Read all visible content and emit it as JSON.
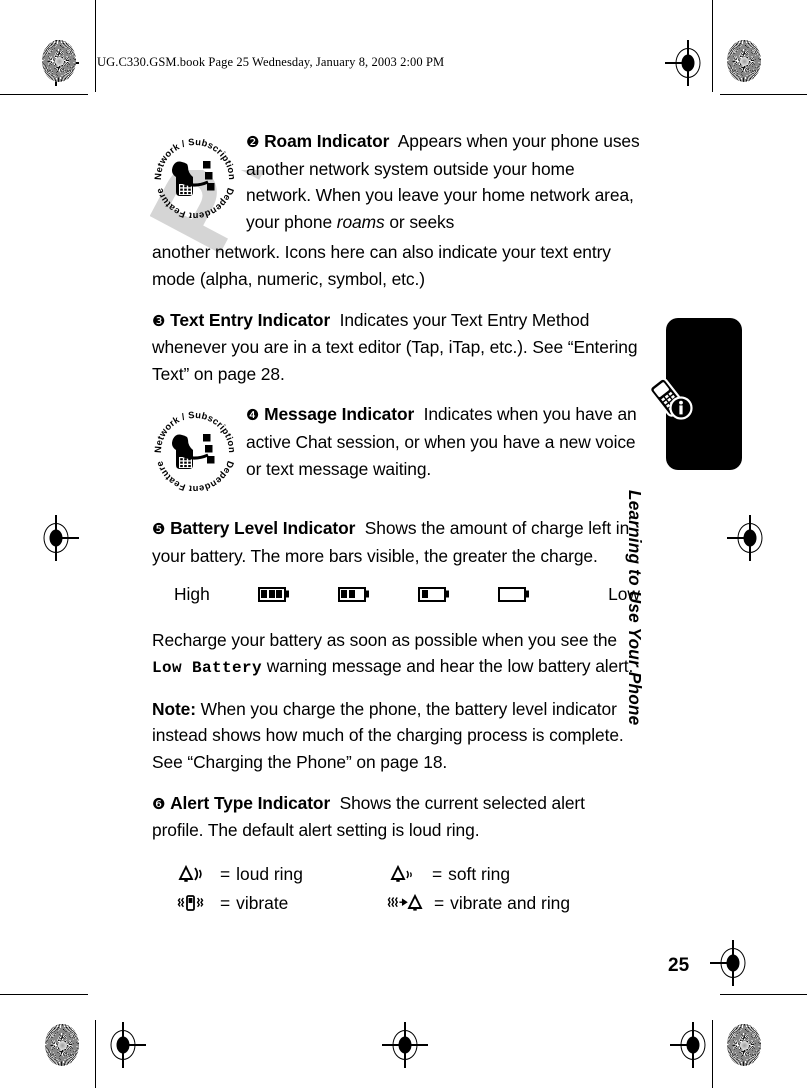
{
  "header": {
    "file_line": "UG.C330.GSM.book  Page 25  Wednesday, January 8, 2003  2:00 PM"
  },
  "watermark": {
    "text": "PRELIMINARY",
    "color": "#d5d5d5"
  },
  "badge": {
    "line1": "Network / Subscription",
    "line2": "Dependent Feature",
    "name": "network-subscription-dependent-feature-badge"
  },
  "sections": [
    {
      "marker": "❷",
      "title": "Roam Indicator",
      "body_part1": "Appears when your phone uses another network system outside your home network. When you leave your home network area, your phone ",
      "italic": "roams",
      "body_part2": " or seeks",
      "overflow": "another network. Icons here can also indicate your text entry mode (alpha, numeric, symbol, etc.)",
      "has_badge": true
    },
    {
      "marker": "❸",
      "title": "Text Entry Indicator",
      "body": "Indicates your Text Entry Method whenever you are in a text editor (Tap, iTap, etc.). See “Entering Text” on page 28.",
      "has_badge": false
    },
    {
      "marker": "❹",
      "title": "Message Indicator",
      "body": "Indicates when you have an active Chat session, or when you have a new voice or text message waiting.",
      "has_badge": true
    },
    {
      "marker": "❺",
      "title": "Battery Level Indicator",
      "body": "Shows the amount of charge left in your battery. The more bars visible, the greater the charge.",
      "has_badge": false
    },
    {
      "marker": "❻",
      "title": "Alert Type Indicator",
      "body": "Shows the current selected alert profile. The default alert setting is loud ring.",
      "has_badge": false
    }
  ],
  "battery_scale": {
    "high_label": "High",
    "low_label": "Low",
    "levels": [
      3,
      2,
      1,
      0
    ]
  },
  "recharge_para": {
    "before": "Recharge your battery as soon as possible when you see the ",
    "mono": "Low Battery",
    "after": " warning message and hear the low battery alert."
  },
  "note_para": {
    "label": "Note:",
    "body": " When you charge the phone, the battery level indicator instead shows how much of the charging process is complete. See “Charging the Phone” on page 18."
  },
  "alert_legend": [
    [
      {
        "icon": "bell-loud-ring-icon",
        "eq": "=",
        "label": "loud ring"
      },
      {
        "icon": "bell-soft-ring-icon",
        "eq": "=",
        "label": "soft ring"
      }
    ],
    [
      {
        "icon": "vibrate-icon",
        "eq": "=",
        "label": "vibrate"
      },
      {
        "icon": "vibrate-and-ring-icon",
        "eq": "=",
        "label": "vibrate and ring"
      }
    ]
  ],
  "side_tab": {
    "title": "Learning to Use Your Phone",
    "icon": "phone-info-icon",
    "color": "#000000"
  },
  "page_number": "25"
}
